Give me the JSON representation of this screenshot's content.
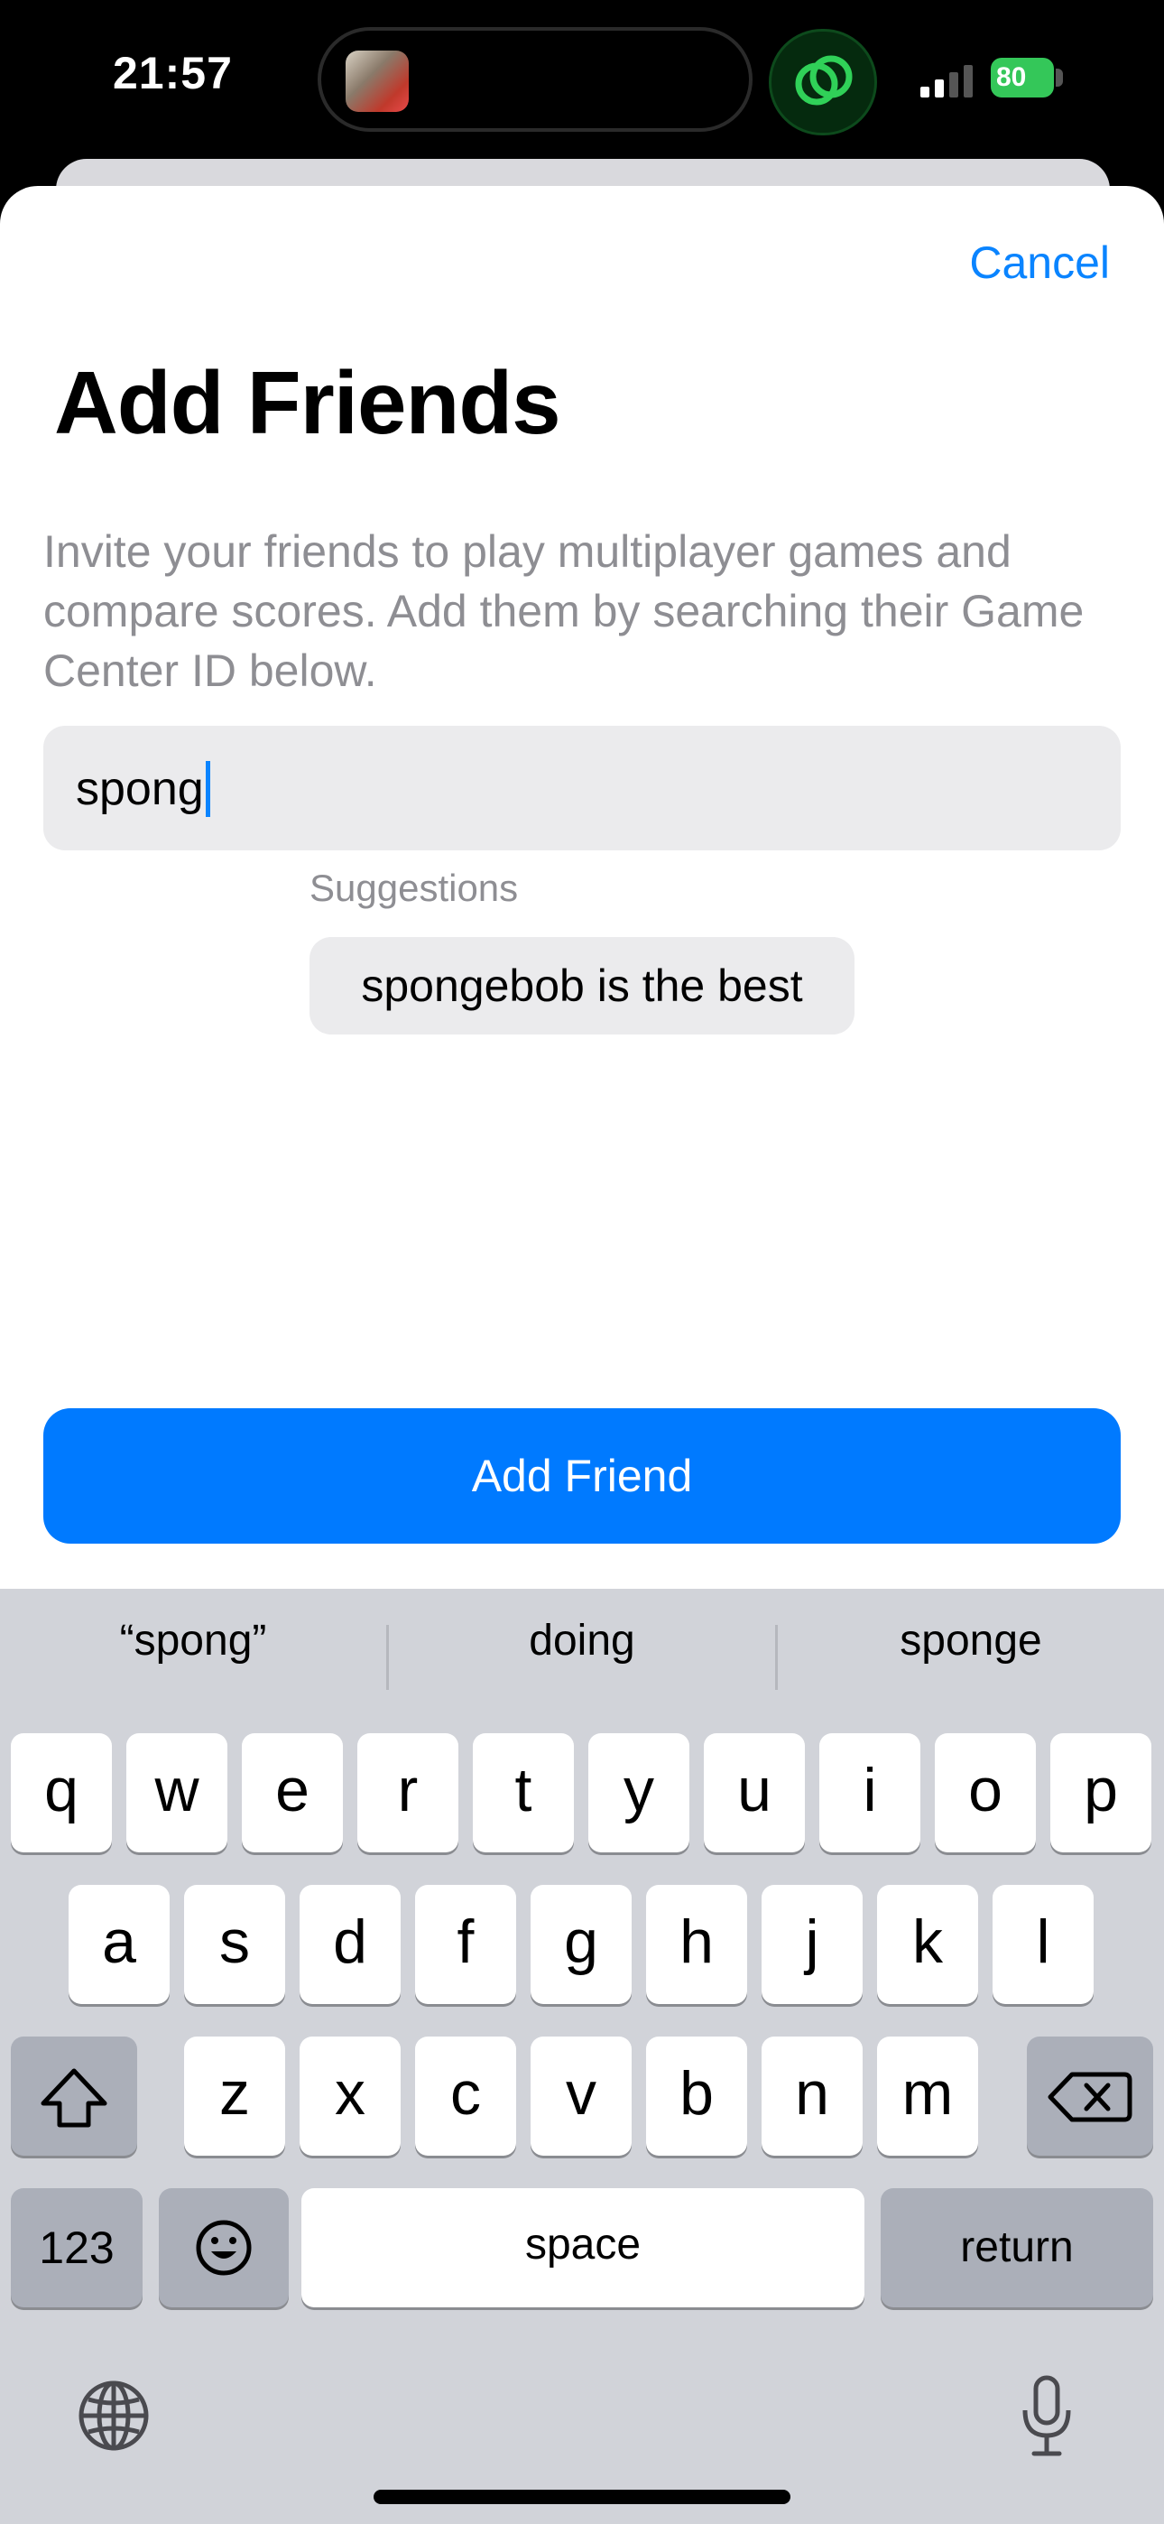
{
  "status_bar": {
    "time": "21:57",
    "battery": "80"
  },
  "header": {
    "cancel": "Cancel",
    "title": "Add Friends",
    "description": "Invite your friends to play multiplayer games and compare scores. Add them by searching their Game Center ID below."
  },
  "search": {
    "value": "spong"
  },
  "suggestions": {
    "label": "Suggestions",
    "items": [
      "spongebob is the best"
    ]
  },
  "action": {
    "add_friend": "Add Friend"
  },
  "keyboard": {
    "predictions": [
      "“spong”",
      "doing",
      "sponge"
    ],
    "row1": [
      "q",
      "w",
      "e",
      "r",
      "t",
      "y",
      "u",
      "i",
      "o",
      "p"
    ],
    "row2": [
      "a",
      "s",
      "d",
      "f",
      "g",
      "h",
      "j",
      "k",
      "l"
    ],
    "row3": [
      "z",
      "x",
      "c",
      "v",
      "b",
      "n",
      "m"
    ],
    "numbers": "123",
    "space": "space",
    "return": "return"
  },
  "colors": {
    "accent": "#007aff",
    "link": "#0a84ff",
    "keyboard_bg": "#d1d3d9",
    "battery": "#34c759"
  },
  "icons": [
    "thumbnail-icon",
    "link-circles-icon",
    "cellular-signal-icon",
    "battery-icon",
    "shift-icon",
    "backspace-icon",
    "emoji-icon",
    "globe-icon",
    "microphone-icon"
  ]
}
